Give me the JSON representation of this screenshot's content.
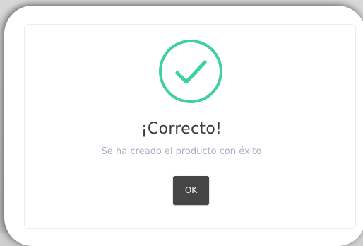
{
  "dialog": {
    "title": "¡Correcto!",
    "message": "Se ha creado el producto con éxito",
    "ok_label": "OK",
    "icon": "check-circle-icon",
    "accent_color": "#3fcfa5",
    "button_color": "#454545"
  }
}
